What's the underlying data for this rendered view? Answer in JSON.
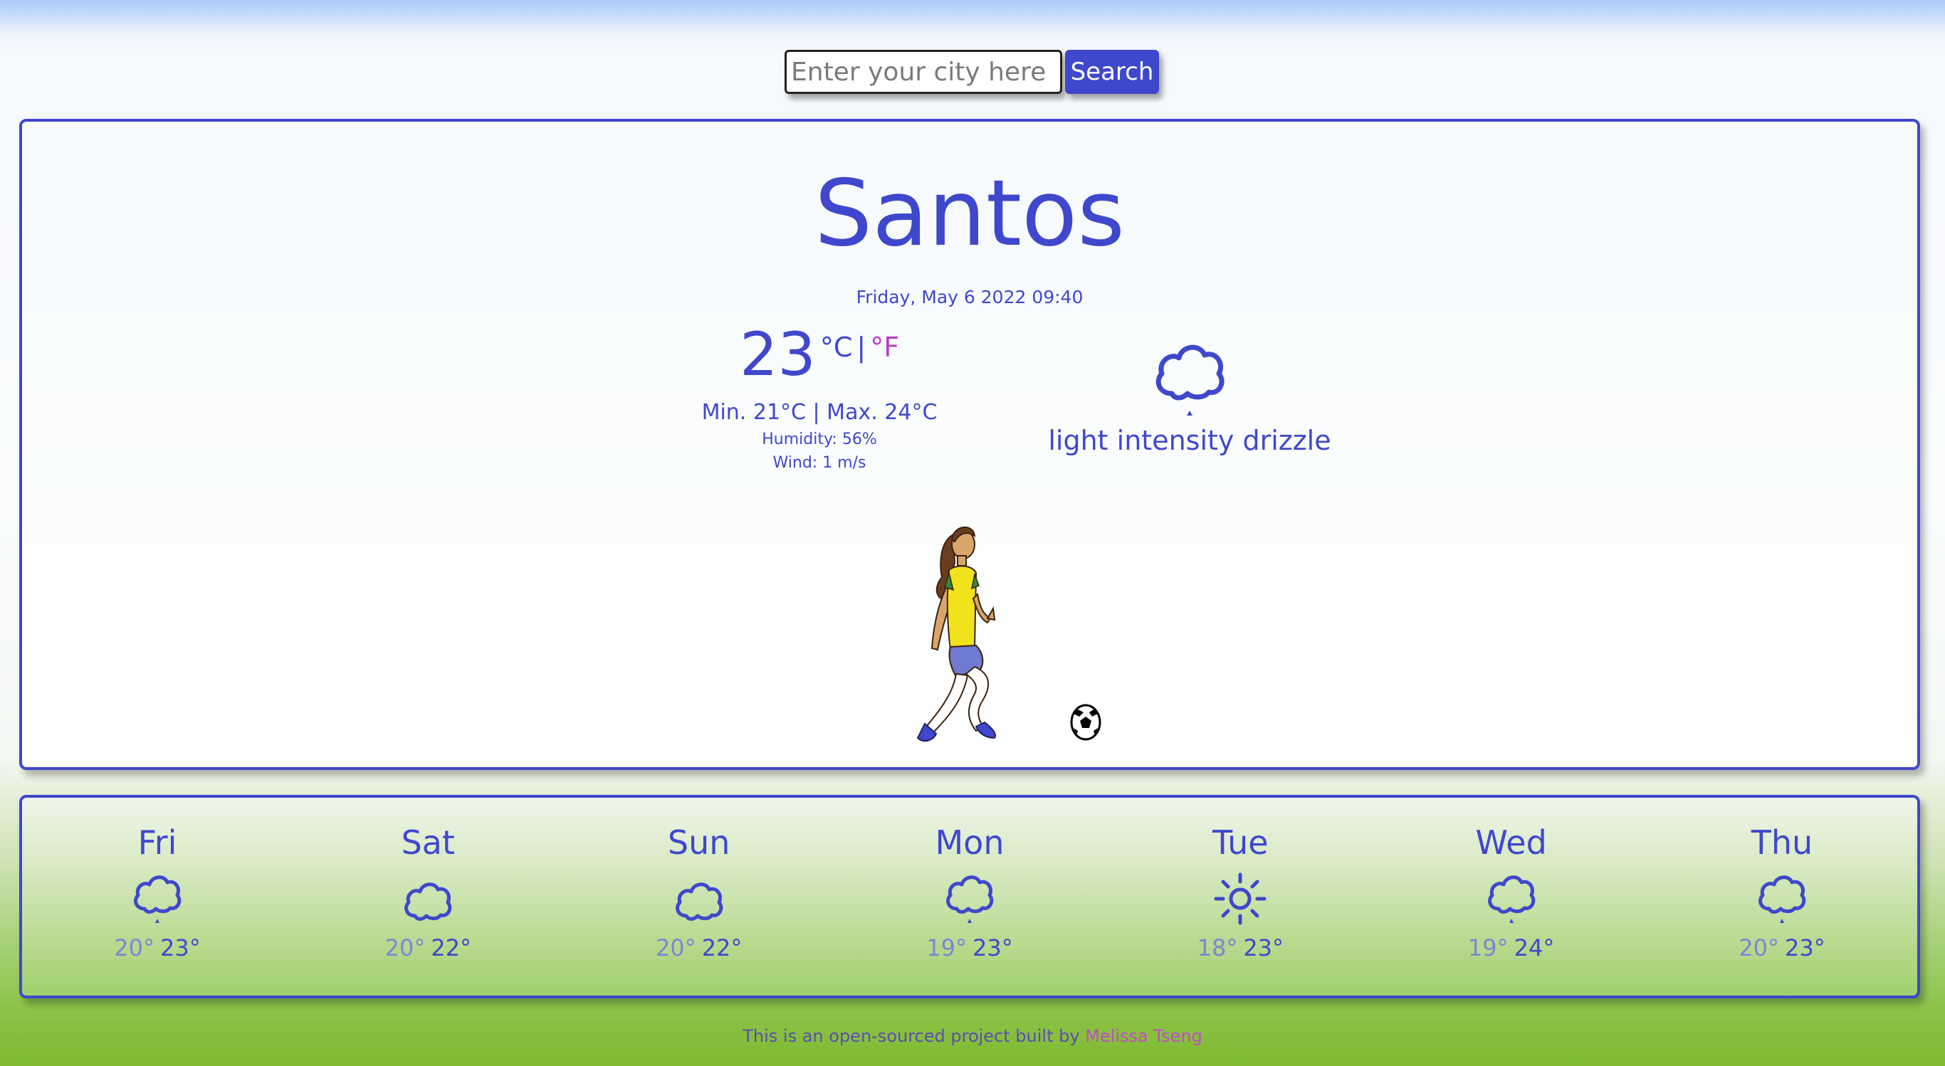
{
  "search": {
    "placeholder": "Enter your city here",
    "button_label": "Search"
  },
  "current": {
    "city": "Santos",
    "datetime": "Friday, May 6 2022 09:40",
    "temperature": "23",
    "unit_celsius": "°C",
    "unit_separator": "|",
    "unit_fahrenheit": "°F",
    "minmax": "Min. 21°C | Max. 24°C",
    "humidity": "Humidity: 56%",
    "wind": "Wind: 1 m/s",
    "icon": "drizzle-cloud-icon",
    "description": "light intensity drizzle"
  },
  "forecast": [
    {
      "day": "Fri",
      "icon": "drizzle-cloud-icon",
      "min": "20°",
      "max": "23°"
    },
    {
      "day": "Sat",
      "icon": "cloud-icon",
      "min": "20°",
      "max": "22°"
    },
    {
      "day": "Sun",
      "icon": "cloud-icon",
      "min": "20°",
      "max": "22°"
    },
    {
      "day": "Mon",
      "icon": "drizzle-cloud-icon",
      "min": "19°",
      "max": "23°"
    },
    {
      "day": "Tue",
      "icon": "sun-icon",
      "min": "18°",
      "max": "23°"
    },
    {
      "day": "Wed",
      "icon": "drizzle-cloud-icon",
      "min": "19°",
      "max": "24°"
    },
    {
      "day": "Thu",
      "icon": "drizzle-cloud-icon",
      "min": "20°",
      "max": "23°"
    }
  ],
  "footer": {
    "text": "This is an open-sourced project built by",
    "author": "Melissa Tseng"
  },
  "colors": {
    "accent": "#3f48cc",
    "fahrenheit": "#b73fc0",
    "author_link": "#c24cc4"
  }
}
